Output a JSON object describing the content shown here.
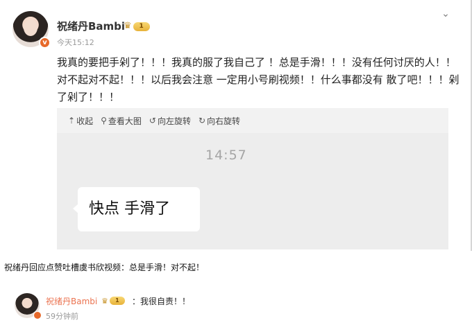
{
  "post": {
    "username": "祝绪丹Bambi",
    "vip_level": "1",
    "timestamp": "今天15:12",
    "lines": [
      "我真的要把手剁了！！！我真的服了我自己了 ！总是手滑！！！没有任何讨厌的人！！",
      "对不起对不起！！！以后我会注意 一定用小号刷视频！！什么事都没有 散了吧！！！剁",
      "了剁了！！！"
    ],
    "more_icon": "chevron-down-icon"
  },
  "media": {
    "toolbar": {
      "collapse": "收起",
      "view_large": "查看大图",
      "rotate_left": "向左旋转",
      "rotate_right": "向右旋转"
    },
    "chat_time": "14:57",
    "bubble_text": "快点 手滑了"
  },
  "caption": "祝绪丹回应点赞吐槽虞书欣视频：总是手滑！对不起！",
  "comment": {
    "username": "祝绪丹Bambi",
    "vip_level": "1",
    "text": "：我很自责！！",
    "time": "59分钟前"
  },
  "colors": {
    "name_orange": "#eb7350",
    "media_bg": "#f2f2f2",
    "chat_bg": "#ededed"
  }
}
